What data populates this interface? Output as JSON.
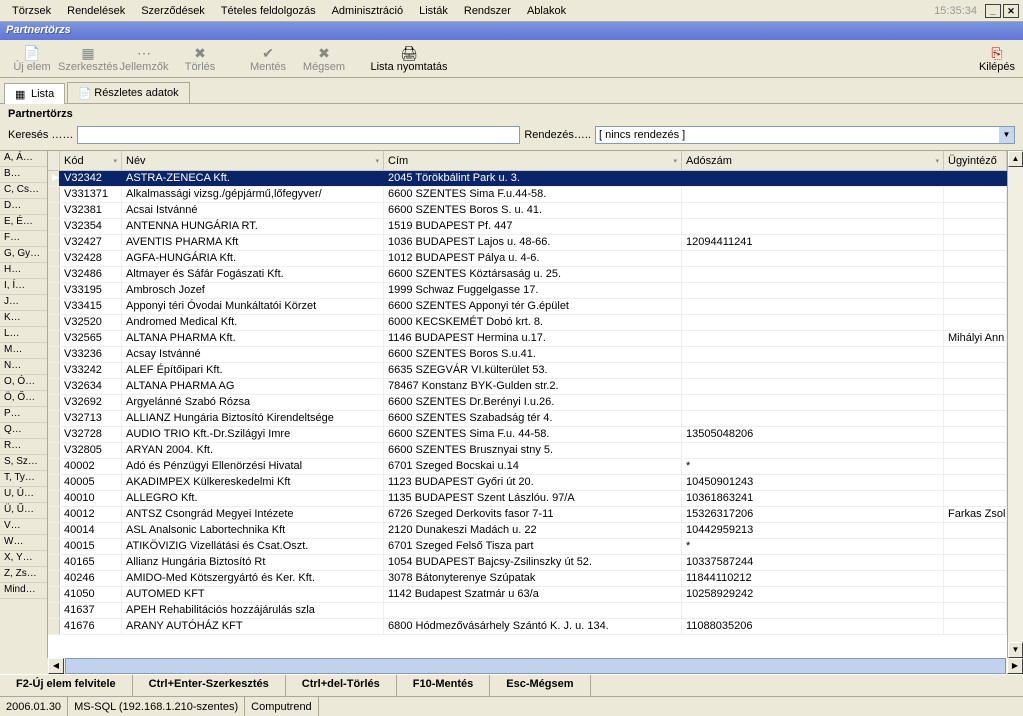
{
  "menubar": {
    "items": [
      "Törzsek",
      "Rendelések",
      "Szerződések",
      "Tételes feldolgozás",
      "Adminisztráció",
      "Listák",
      "Rendszer",
      "Ablakok"
    ],
    "time": "15:35:34"
  },
  "window_title": "Partnertörzs",
  "toolbar": {
    "uj_elem": "Új elem",
    "szerkesztes": "Szerkesztés",
    "jellemzok": "Jellemzők",
    "torles": "Törlés",
    "mentes": "Mentés",
    "megsem": "Mégsem",
    "lista_nyomtatas": "Lista nyomtatás",
    "kilepes": "Kilépés"
  },
  "tabs": {
    "lista": "Lista",
    "reszletes": "Részletes adatok"
  },
  "section": "Partnertörzs",
  "search": {
    "label": "Keresés ……",
    "value": "",
    "sort_label": "Rendezés…..",
    "sort_value": "[ nincs rendezés ]"
  },
  "alpha": [
    "A, Á…",
    "B…",
    "C, Cs…",
    "D…",
    "E, É…",
    "F…",
    "G, Gy…",
    "H…",
    "I, Í…",
    "J…",
    "K…",
    "L…",
    "M…",
    "N…",
    "O, Ó…",
    "Ö, Ő…",
    "P…",
    "Q…",
    "R…",
    "S, Sz…",
    "T, Ty…",
    "U, Ú…",
    "Ü, Ű…",
    "V…",
    "W…",
    "X, Y…",
    "Z, Zs…",
    "Mind…"
  ],
  "columns": {
    "kod": "Kód",
    "nev": "Név",
    "cim": "Cím",
    "adoszam": "Adószám",
    "ugyintezo": "Ügyintéző"
  },
  "rows": [
    {
      "kod": "V32342",
      "nev": "ASTRA-ZENECA Kft.",
      "cim": "2045 Törökbálint Park u. 3.",
      "ado": "",
      "ugy": ""
    },
    {
      "kod": "V331371",
      "nev": "Alkalmassági vizsg./gépjármű,lőfegyver/",
      "cim": "6600 SZENTES Sima F.u.44-58.",
      "ado": "",
      "ugy": ""
    },
    {
      "kod": "V32381",
      "nev": "Acsai Istvánné",
      "cim": "6600 SZENTES Boros S. u. 41.",
      "ado": "",
      "ugy": ""
    },
    {
      "kod": "V32354",
      "nev": "ANTENNA HUNGÁRIA RT.",
      "cim": "1519 BUDAPEST Pf. 447",
      "ado": "",
      "ugy": ""
    },
    {
      "kod": "V32427",
      "nev": "AVENTIS PHARMA Kft",
      "cim": "1036 BUDAPEST Lajos u. 48-66.",
      "ado": "12094411241",
      "ugy": ""
    },
    {
      "kod": "V32428",
      "nev": "AGFA-HUNGÁRIA Kft.",
      "cim": "1012 BUDAPEST Pálya u. 4-6.",
      "ado": "",
      "ugy": ""
    },
    {
      "kod": "V32486",
      "nev": "Altmayer és Sáfár Fogászati Kft.",
      "cim": "6600 SZENTES Köztársaság u. 25.",
      "ado": "",
      "ugy": ""
    },
    {
      "kod": "V33195",
      "nev": "Ambrosch Jozef",
      "cim": "1999 Schwaz Fuggelgasse 17.",
      "ado": "",
      "ugy": ""
    },
    {
      "kod": "V33415",
      "nev": "Apponyi téri Óvodai Munkáltatói Körzet",
      "cim": "6600 SZENTES Apponyi tér G.épület",
      "ado": "",
      "ugy": ""
    },
    {
      "kod": "V32520",
      "nev": "Andromed Medical Kft.",
      "cim": "6000 KECSKEMÉT Dobó krt. 8.",
      "ado": "",
      "ugy": ""
    },
    {
      "kod": "V32565",
      "nev": "ALTANA PHARMA Kft.",
      "cim": "1146 BUDAPEST Hermina u.17.",
      "ado": "",
      "ugy": "Mihályi Ann"
    },
    {
      "kod": "V33236",
      "nev": "Acsay Istvánné",
      "cim": "6600 SZENTES Boros S.u.41.",
      "ado": "",
      "ugy": ""
    },
    {
      "kod": "V33242",
      "nev": "ALEF Építőipari Kft.",
      "cim": "6635 SZEGVÁR VI.külterület 53.",
      "ado": "",
      "ugy": ""
    },
    {
      "kod": "V32634",
      "nev": "ALTANA PHARMA AG",
      "cim": " 78467 Konstanz BYK-Gulden str.2.",
      "ado": "",
      "ugy": ""
    },
    {
      "kod": "V32692",
      "nev": "Argyelánné Szabó Rózsa",
      "cim": "6600 SZENTES Dr.Berényi I.u.26.",
      "ado": "",
      "ugy": ""
    },
    {
      "kod": "V32713",
      "nev": "ALLIANZ Hungária Biztosító Kirendeltsége",
      "cim": "6600 SZENTES Szabadság tér 4.",
      "ado": "",
      "ugy": ""
    },
    {
      "kod": "V32728",
      "nev": "AUDIO TRIO Kft.-Dr.Szilágyi Imre",
      "cim": "6600 SZENTES Sima F.u. 44-58.",
      "ado": "13505048206",
      "ugy": ""
    },
    {
      "kod": "V32805",
      "nev": "ARYAN 2004. Kft.",
      "cim": "6600 SZENTES Brusznyai stny 5.",
      "ado": "",
      "ugy": ""
    },
    {
      "kod": "40002",
      "nev": "Adó és Pénzügyi Ellenörzési Hivatal",
      "cim": "6701 Szeged Bocskai u.14",
      "ado": "*",
      "ugy": ""
    },
    {
      "kod": "40005",
      "nev": "AKADIMPEX Külkereskedelmi Kft",
      "cim": "1123 BUDAPEST Győri út 20.",
      "ado": "10450901243",
      "ugy": ""
    },
    {
      "kod": "40010",
      "nev": "ALLEGRO Kft.",
      "cim": "1135 BUDAPEST Szent Lászlóu. 97/A",
      "ado": "10361863241",
      "ugy": ""
    },
    {
      "kod": "40012",
      "nev": "ANTSZ Csongrád Megyei Intézete",
      "cim": "6726 Szeged Derkovits fasor 7-11",
      "ado": "15326317206",
      "ugy": "Farkas Zsol"
    },
    {
      "kod": "40014",
      "nev": "ASL Analsonic Labortechnika Kft",
      "cim": "2120 Dunakeszi Madách u. 22",
      "ado": "10442959213",
      "ugy": ""
    },
    {
      "kod": "40015",
      "nev": "ATIKÖVIZIG Vizellátási és Csat.Oszt.",
      "cim": "6701 Szeged Felső Tisza part",
      "ado": "*",
      "ugy": ""
    },
    {
      "kod": "40165",
      "nev": "Allianz Hungária Biztosító Rt",
      "cim": "1054 BUDAPEST Bajcsy-Zsilinszky út 52.",
      "ado": "10337587244",
      "ugy": ""
    },
    {
      "kod": "40246",
      "nev": "AMIDO-Med Kötszergyártó és Ker. Kft.",
      "cim": "3078 Bátonyterenye Szúpatak",
      "ado": "11844110212",
      "ugy": ""
    },
    {
      "kod": "41050",
      "nev": "AUTOMED KFT",
      "cim": "1142 Budapest Szatmár u 63/a",
      "ado": "10258929242",
      "ugy": ""
    },
    {
      "kod": "41637",
      "nev": "APEH Rehabilitációs hozzájárulás szla",
      "cim": "",
      "ado": "",
      "ugy": ""
    },
    {
      "kod": "41676",
      "nev": "ARANY AUTÓHÁZ KFT",
      "cim": "6800 Hódmezővásárhely Szántó K. J. u. 134.",
      "ado": "11088035206",
      "ugy": ""
    }
  ],
  "shortcuts": [
    "F2-Új elem felvitele",
    "Ctrl+Enter-Szerkesztés",
    "Ctrl+del-Törlés",
    "F10-Mentés",
    "Esc-Mégsem"
  ],
  "status": {
    "date": "2006.01.30",
    "conn": "MS-SQL (192.168.1.210-szentes)",
    "app": "Computrend"
  }
}
